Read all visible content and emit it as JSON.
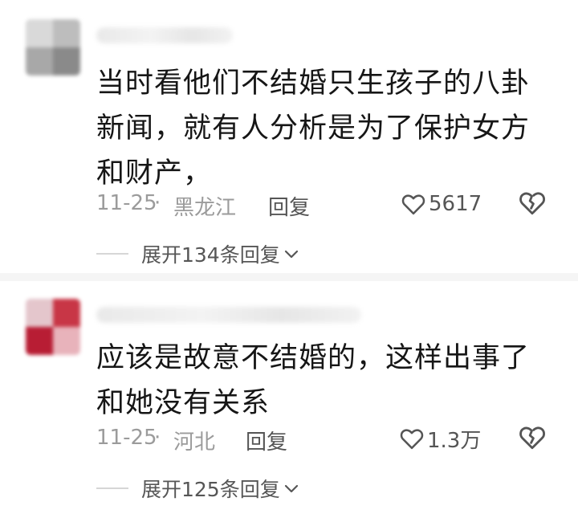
{
  "comments": [
    {
      "text": "当时看他们不结婚只生孩子的八卦新闻，就有人分析是为了保护女方和财产，",
      "date": "11-25",
      "separator": "·",
      "region": "黑龙江",
      "reply_label": "回复",
      "likes": "5617",
      "expand_label": "展开134条回复"
    },
    {
      "text": "应该是故意不结婚的，这样出事了和她没有关系",
      "date": "11-25",
      "separator": "·",
      "region": "河北",
      "reply_label": "回复",
      "likes": "1.3万",
      "expand_label": "展开125条回复"
    }
  ],
  "icons": {
    "like": "heart-outline-icon",
    "dislike": "broken-heart-icon",
    "expand": "chevron-down-icon"
  },
  "colors": {
    "text": "#161616",
    "meta": "#9b9b9b",
    "action": "#555555",
    "divider": "#f5f5f5"
  }
}
